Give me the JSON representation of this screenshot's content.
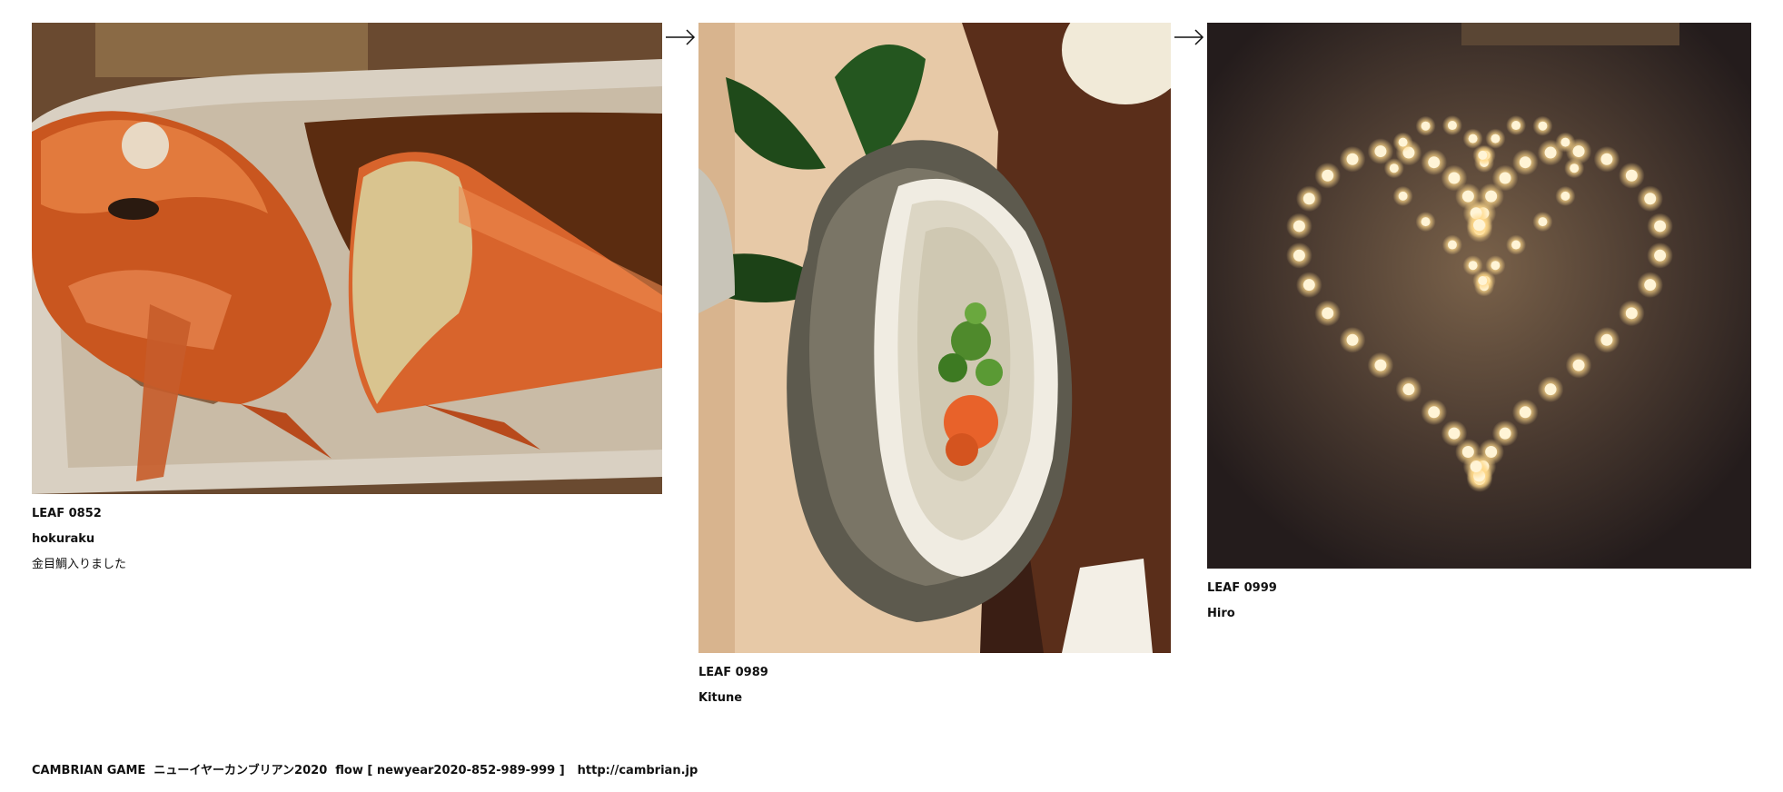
{
  "leaves": [
    {
      "number": "LEAF 0852",
      "author": "hokuraku",
      "comment": "金目鯛入りました",
      "photo": "simmered-kinmedai-fish",
      "palette": {
        "plate": "#d9d0c2",
        "sauce": "#5b2c10",
        "fish": "#d8642c",
        "flesh": "#d9c48f"
      }
    },
    {
      "number": "LEAF 0989",
      "author": "Kitune",
      "comment": "",
      "photo": "raw-oyster-on-plate",
      "palette": {
        "plate": "#e7c9a7",
        "shell": "#6e6a5c",
        "oyster": "#dcd6c4",
        "leaf": "#1f4a1a",
        "garnish": "#e8622a"
      }
    },
    {
      "number": "LEAF 0999",
      "author": "Hiro",
      "comment": "",
      "photo": "candle-heart-on-sand",
      "palette": {
        "ground": "#3a2c28",
        "glow": "#8a6a4a",
        "candle": "#ffe9b8"
      }
    }
  ],
  "arrows": [
    {
      "icon": "arrow-right-icon"
    },
    {
      "icon": "arrow-right-icon"
    }
  ],
  "footer": {
    "text": "CAMBRIAN GAME  ニューイヤーカンブリアン2020  flow [ newyear2020-852-989-999 ]",
    "link": "http://cambrian.jp"
  }
}
